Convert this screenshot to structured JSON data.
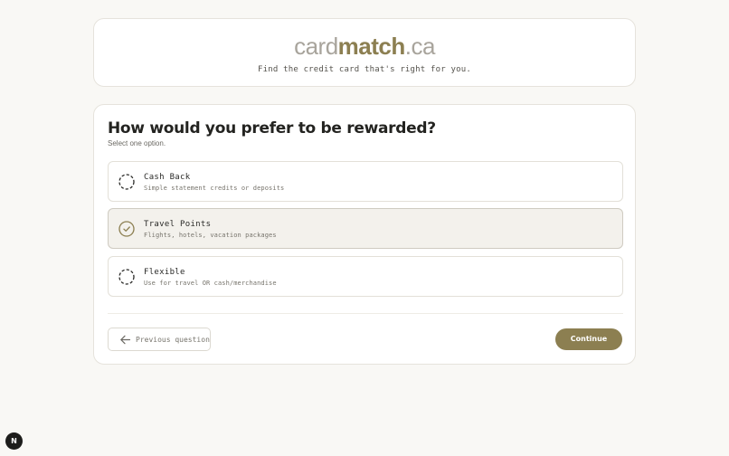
{
  "brand": {
    "logo_part1": "card",
    "logo_part2": "match",
    "logo_part3": ".ca",
    "tagline": "Find the credit card that's right for you."
  },
  "quiz": {
    "question": "How would you prefer to be rewarded?",
    "hint": "Select one option.",
    "options": [
      {
        "title": "Cash Back",
        "description": "Simple statement credits or deposits",
        "selected": false
      },
      {
        "title": "Travel Points",
        "description": "Flights, hotels, vacation packages",
        "selected": true
      },
      {
        "title": "Flexible",
        "description": "Use for travel OR cash/merchandise",
        "selected": false
      }
    ],
    "previous_label": "Previous question",
    "continue_label": "Continue"
  },
  "fab": {
    "label": "N"
  },
  "colors": {
    "accent": "#8c7f51",
    "background": "#f9f8f5",
    "selected_option_bg": "#f3f1ec"
  }
}
